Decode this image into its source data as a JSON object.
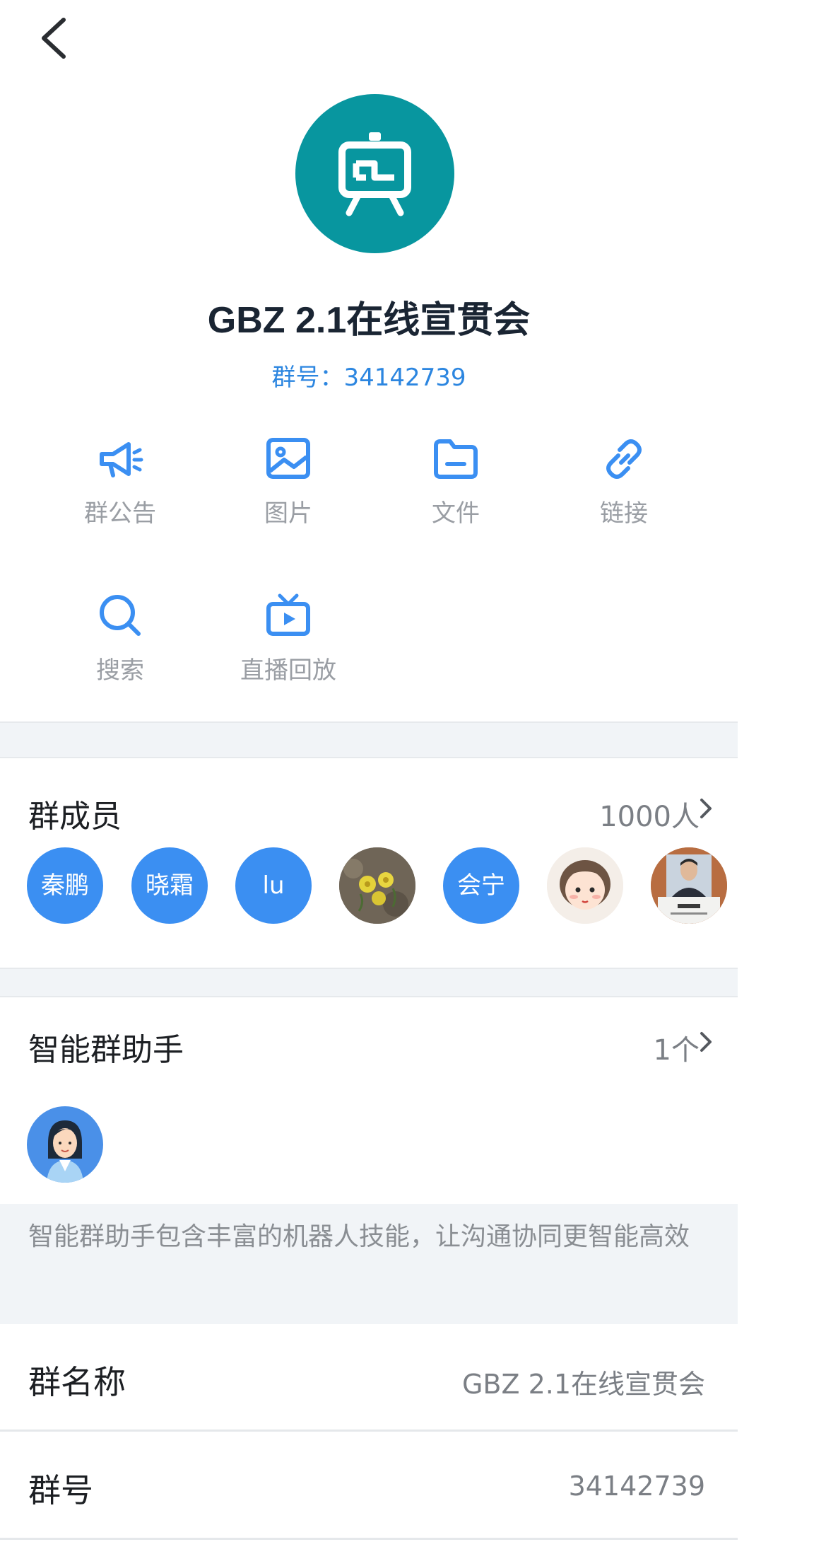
{
  "header": {
    "back_icon": "chevron-left-icon"
  },
  "group": {
    "avatar_icon": "easel-presentation-icon",
    "avatar_color": "#08969f",
    "name": "GBZ 2.1在线宣贯会",
    "id_line": "群号：34142739"
  },
  "actions": [
    {
      "label": "群公告",
      "icon": "megaphone-icon"
    },
    {
      "label": "图片",
      "icon": "image-icon"
    },
    {
      "label": "文件",
      "icon": "folder-icon"
    },
    {
      "label": "链接",
      "icon": "link-icon"
    },
    {
      "label": "搜索",
      "icon": "search-icon"
    },
    {
      "label": "直播回放",
      "icon": "tv-play-icon"
    }
  ],
  "members": {
    "title": "群成员",
    "count": "1000人",
    "list": [
      {
        "label": "秦鹏",
        "type": "text"
      },
      {
        "label": "晓霜",
        "type": "text"
      },
      {
        "label": "lu",
        "type": "text"
      },
      {
        "label": "",
        "type": "photo-flowers"
      },
      {
        "label": "会宁",
        "type": "text"
      },
      {
        "label": "",
        "type": "cartoon-girl"
      },
      {
        "label": "",
        "type": "photo-man"
      }
    ]
  },
  "assistant": {
    "title": "智能群助手",
    "count": "1个",
    "description": "智能群助手包含丰富的机器人技能，让沟通协同更智能高效"
  },
  "info": {
    "name_label": "群名称",
    "name_value": "GBZ 2.1在线宣贯会",
    "id_label": "群号",
    "id_value": "34142739"
  },
  "colors": {
    "accent": "#2c86e0",
    "icon_blue": "#3b8ff2",
    "separator": "#f1f4f7"
  }
}
